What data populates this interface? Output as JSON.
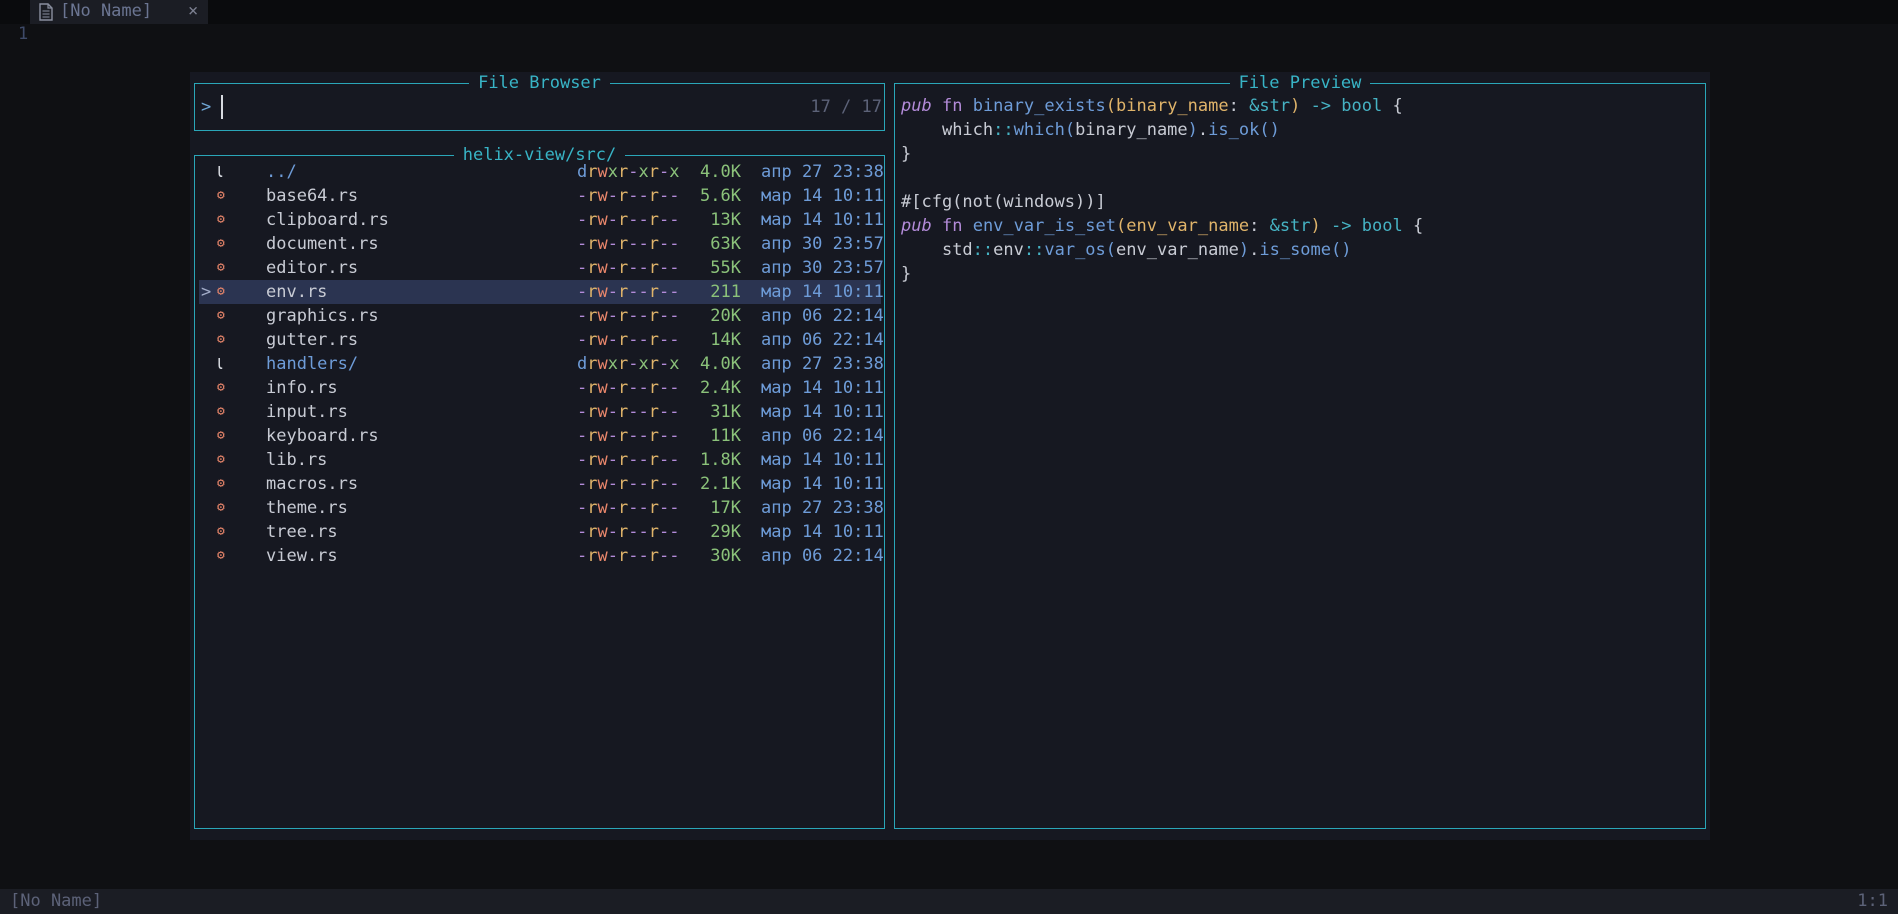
{
  "bufferline": {
    "tab_label": "[No Name]",
    "close_glyph": "×"
  },
  "editor": {
    "line_number": "1"
  },
  "picker": {
    "title": "File Browser",
    "prompt_symbol": ">",
    "query": "",
    "count": "17 / 17",
    "directory": "helix-view/src/",
    "selected_marker": ">",
    "files": [
      {
        "name": "../",
        "type": "dir",
        "icon": "folder-icon",
        "perm": "drwxr-xr-x",
        "size": "4.0K",
        "date": "апр 27 23:38"
      },
      {
        "name": "base64.rs",
        "type": "file",
        "icon": "rust-icon",
        "perm": "-rw-r--r--",
        "size": "5.6K",
        "date": "мар 14 10:11"
      },
      {
        "name": "clipboard.rs",
        "type": "file",
        "icon": "rust-icon",
        "perm": "-rw-r--r--",
        "size": "13K",
        "date": "мар 14 10:11"
      },
      {
        "name": "document.rs",
        "type": "file",
        "icon": "rust-icon",
        "perm": "-rw-r--r--",
        "size": "63K",
        "date": "апр 30 23:57"
      },
      {
        "name": "editor.rs",
        "type": "file",
        "icon": "rust-icon",
        "perm": "-rw-r--r--",
        "size": "55K",
        "date": "апр 30 23:57"
      },
      {
        "name": "env.rs",
        "type": "file",
        "icon": "rust-icon",
        "perm": "-rw-r--r--",
        "size": "211",
        "date": "мар 14 10:11",
        "selected": true
      },
      {
        "name": "graphics.rs",
        "type": "file",
        "icon": "rust-icon",
        "perm": "-rw-r--r--",
        "size": "20K",
        "date": "апр 06 22:14"
      },
      {
        "name": "gutter.rs",
        "type": "file",
        "icon": "rust-icon",
        "perm": "-rw-r--r--",
        "size": "14K",
        "date": "апр 06 22:14"
      },
      {
        "name": "handlers/",
        "type": "dir",
        "icon": "folder-icon",
        "perm": "drwxr-xr-x",
        "size": "4.0K",
        "date": "апр 27 23:38"
      },
      {
        "name": "info.rs",
        "type": "file",
        "icon": "rust-icon",
        "perm": "-rw-r--r--",
        "size": "2.4K",
        "date": "мар 14 10:11"
      },
      {
        "name": "input.rs",
        "type": "file",
        "icon": "rust-icon",
        "perm": "-rw-r--r--",
        "size": "31K",
        "date": "мар 14 10:11"
      },
      {
        "name": "keyboard.rs",
        "type": "file",
        "icon": "rust-icon",
        "perm": "-rw-r--r--",
        "size": "11K",
        "date": "апр 06 22:14"
      },
      {
        "name": "lib.rs",
        "type": "file",
        "icon": "rust-icon",
        "perm": "-rw-r--r--",
        "size": "1.8K",
        "date": "мар 14 10:11"
      },
      {
        "name": "macros.rs",
        "type": "file",
        "icon": "rust-icon",
        "perm": "-rw-r--r--",
        "size": "2.1K",
        "date": "мар 14 10:11"
      },
      {
        "name": "theme.rs",
        "type": "file",
        "icon": "rust-icon",
        "perm": "-rw-r--r--",
        "size": "17K",
        "date": "апр 27 23:38"
      },
      {
        "name": "tree.rs",
        "type": "file",
        "icon": "rust-icon",
        "perm": "-rw-r--r--",
        "size": "29K",
        "date": "мар 14 10:11"
      },
      {
        "name": "view.rs",
        "type": "file",
        "icon": "rust-icon",
        "perm": "-rw-r--r--",
        "size": "30K",
        "date": "апр 06 22:14"
      }
    ]
  },
  "preview": {
    "title": "File Preview",
    "code_lines": [
      [
        [
          "kwi",
          "pub"
        ],
        [
          "punc",
          " "
        ],
        [
          "kw",
          "fn"
        ],
        [
          "punc",
          " "
        ],
        [
          "fnc",
          "binary_exists"
        ],
        [
          "br1",
          "("
        ],
        [
          "param",
          "binary_name"
        ],
        [
          "punc",
          ": "
        ],
        [
          "op",
          "&"
        ],
        [
          "typ",
          "str"
        ],
        [
          "br1",
          ")"
        ],
        [
          "punc",
          " "
        ],
        [
          "op",
          "->"
        ],
        [
          "punc",
          " "
        ],
        [
          "typ",
          "bool"
        ],
        [
          "punc",
          " {"
        ]
      ],
      [
        [
          "punc",
          "    "
        ],
        [
          "ns",
          "which"
        ],
        [
          "op",
          "::"
        ],
        [
          "fnc",
          "which"
        ],
        [
          "br2",
          "("
        ],
        [
          "punc",
          "binary_name"
        ],
        [
          "br2",
          ")"
        ],
        [
          "punc",
          "."
        ],
        [
          "fnc",
          "is_ok"
        ],
        [
          "br2",
          "()"
        ]
      ],
      [
        [
          "punc",
          "}"
        ]
      ],
      [],
      [
        [
          "attr",
          "#[cfg(not(windows))]"
        ]
      ],
      [
        [
          "kwi",
          "pub"
        ],
        [
          "punc",
          " "
        ],
        [
          "kw",
          "fn"
        ],
        [
          "punc",
          " "
        ],
        [
          "fnc",
          "env_var_is_set"
        ],
        [
          "br1",
          "("
        ],
        [
          "param",
          "env_var_name"
        ],
        [
          "punc",
          ": "
        ],
        [
          "op",
          "&"
        ],
        [
          "typ",
          "str"
        ],
        [
          "br1",
          ")"
        ],
        [
          "punc",
          " "
        ],
        [
          "op",
          "->"
        ],
        [
          "punc",
          " "
        ],
        [
          "typ",
          "bool"
        ],
        [
          "punc",
          " {"
        ]
      ],
      [
        [
          "punc",
          "    "
        ],
        [
          "ns",
          "std"
        ],
        [
          "op",
          "::"
        ],
        [
          "ns",
          "env"
        ],
        [
          "op",
          "::"
        ],
        [
          "fnc",
          "var_os"
        ],
        [
          "br2",
          "("
        ],
        [
          "punc",
          "env_var_name"
        ],
        [
          "br2",
          ")"
        ],
        [
          "punc",
          "."
        ],
        [
          "fnc",
          "is_some"
        ],
        [
          "br2",
          "()"
        ]
      ],
      [
        [
          "punc",
          "}"
        ]
      ]
    ]
  },
  "statusline": {
    "left": "[No Name]",
    "right": "1:1"
  },
  "colors": {
    "border": "#2aa6b8",
    "perm_dir_d": "#6e9cd8",
    "perm_r": "#e0b46a",
    "perm_w": "#e8866b",
    "perm_x": "#8bc27a",
    "perm_dash": "#b38bd9",
    "rust_icon": "#e8866b",
    "folder_icon": "#d7dae0"
  }
}
